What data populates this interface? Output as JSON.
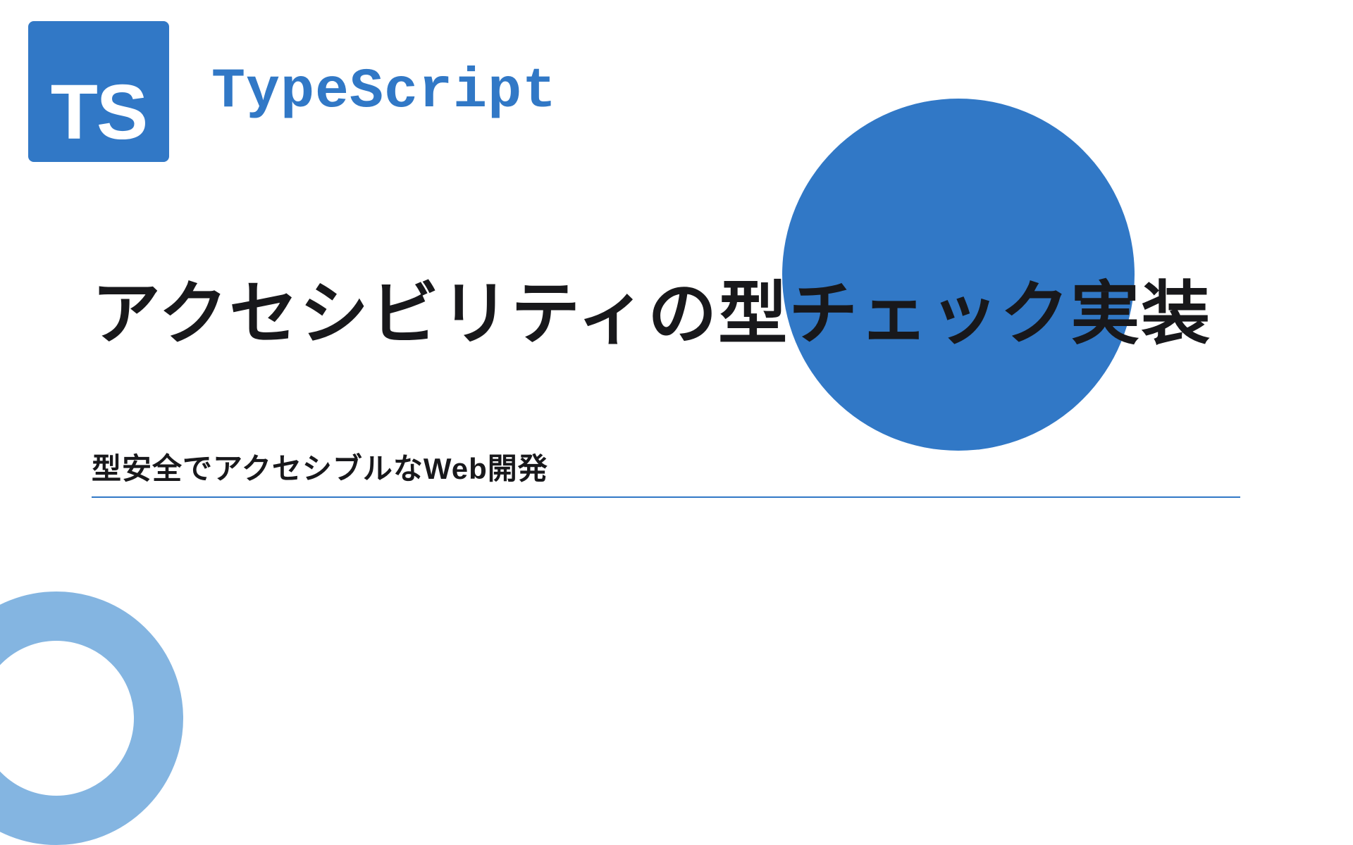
{
  "logo": {
    "badge_text": "TS",
    "label": "TypeScript"
  },
  "title": "アクセシビリティの型チェック実装",
  "subtitle": "型安全でアクセシブルなWeb開発",
  "colors": {
    "brand": "#3178c6",
    "ring": "#6fa8dc"
  }
}
